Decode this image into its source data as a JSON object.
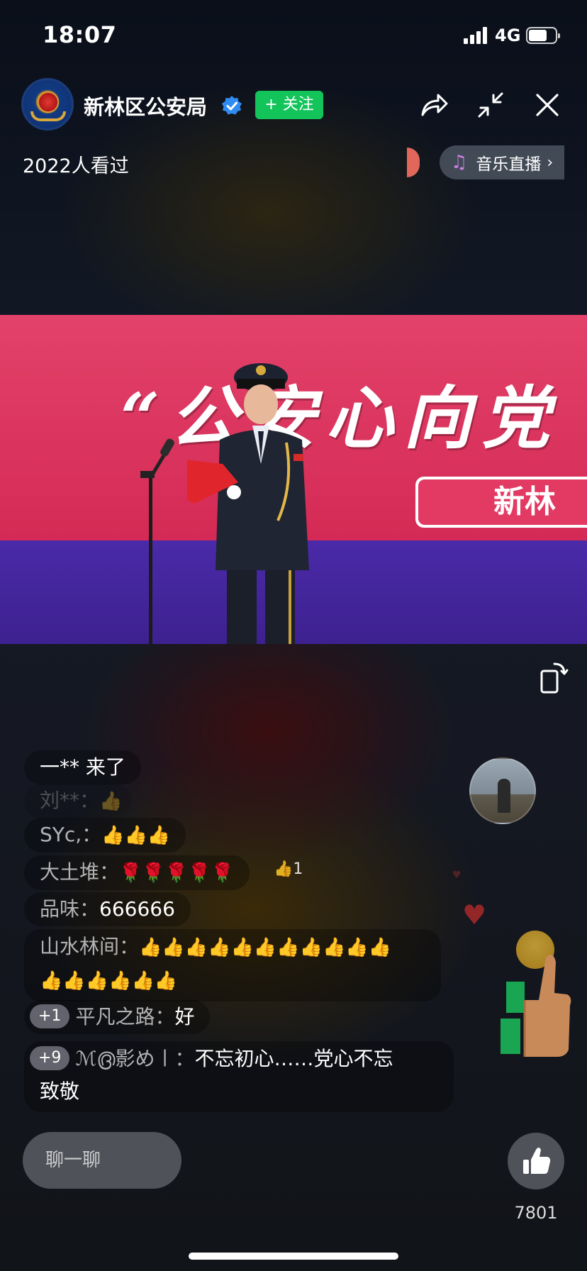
{
  "status_bar": {
    "time": "18:07",
    "network": "4G"
  },
  "header": {
    "channel_name": "新林区公安局",
    "follow_label": "+ 关注",
    "viewers": "2022人看过",
    "music_label": "音乐直播",
    "icons": [
      "share-icon",
      "minimize-icon",
      "close-icon"
    ]
  },
  "video": {
    "slogan": "“公安心向党",
    "subtitle": "新林"
  },
  "comments": [
    {
      "user": "一**",
      "message": "来了"
    },
    {
      "user": "刘**：",
      "message": "👍"
    },
    {
      "user": "SYc,：",
      "message": "👍👍👍"
    },
    {
      "user": "大土堆：",
      "message": "🌹🌹🌹🌹🌹",
      "likes": "1"
    },
    {
      "user": "品味：",
      "message": "666666"
    },
    {
      "user": "山水林间：",
      "message": "👍👍👍👍👍👍👍👍👍👍👍",
      "message2": "👍👍👍👍👍👍"
    },
    {
      "badge": "+1",
      "user": "平凡之路：",
      "message": "好"
    },
    {
      "badge": "+9",
      "user": "ℳ൫影め㇑：",
      "message": "不忘初心……党心不忘",
      "message2": "致敬"
    }
  ],
  "bottom": {
    "chat_placeholder": "聊一聊",
    "like_count": "7801"
  },
  "colors": {
    "follow": "#12c45a",
    "banner_pink": "#d42a55",
    "banner_purple": "#3e2190"
  }
}
